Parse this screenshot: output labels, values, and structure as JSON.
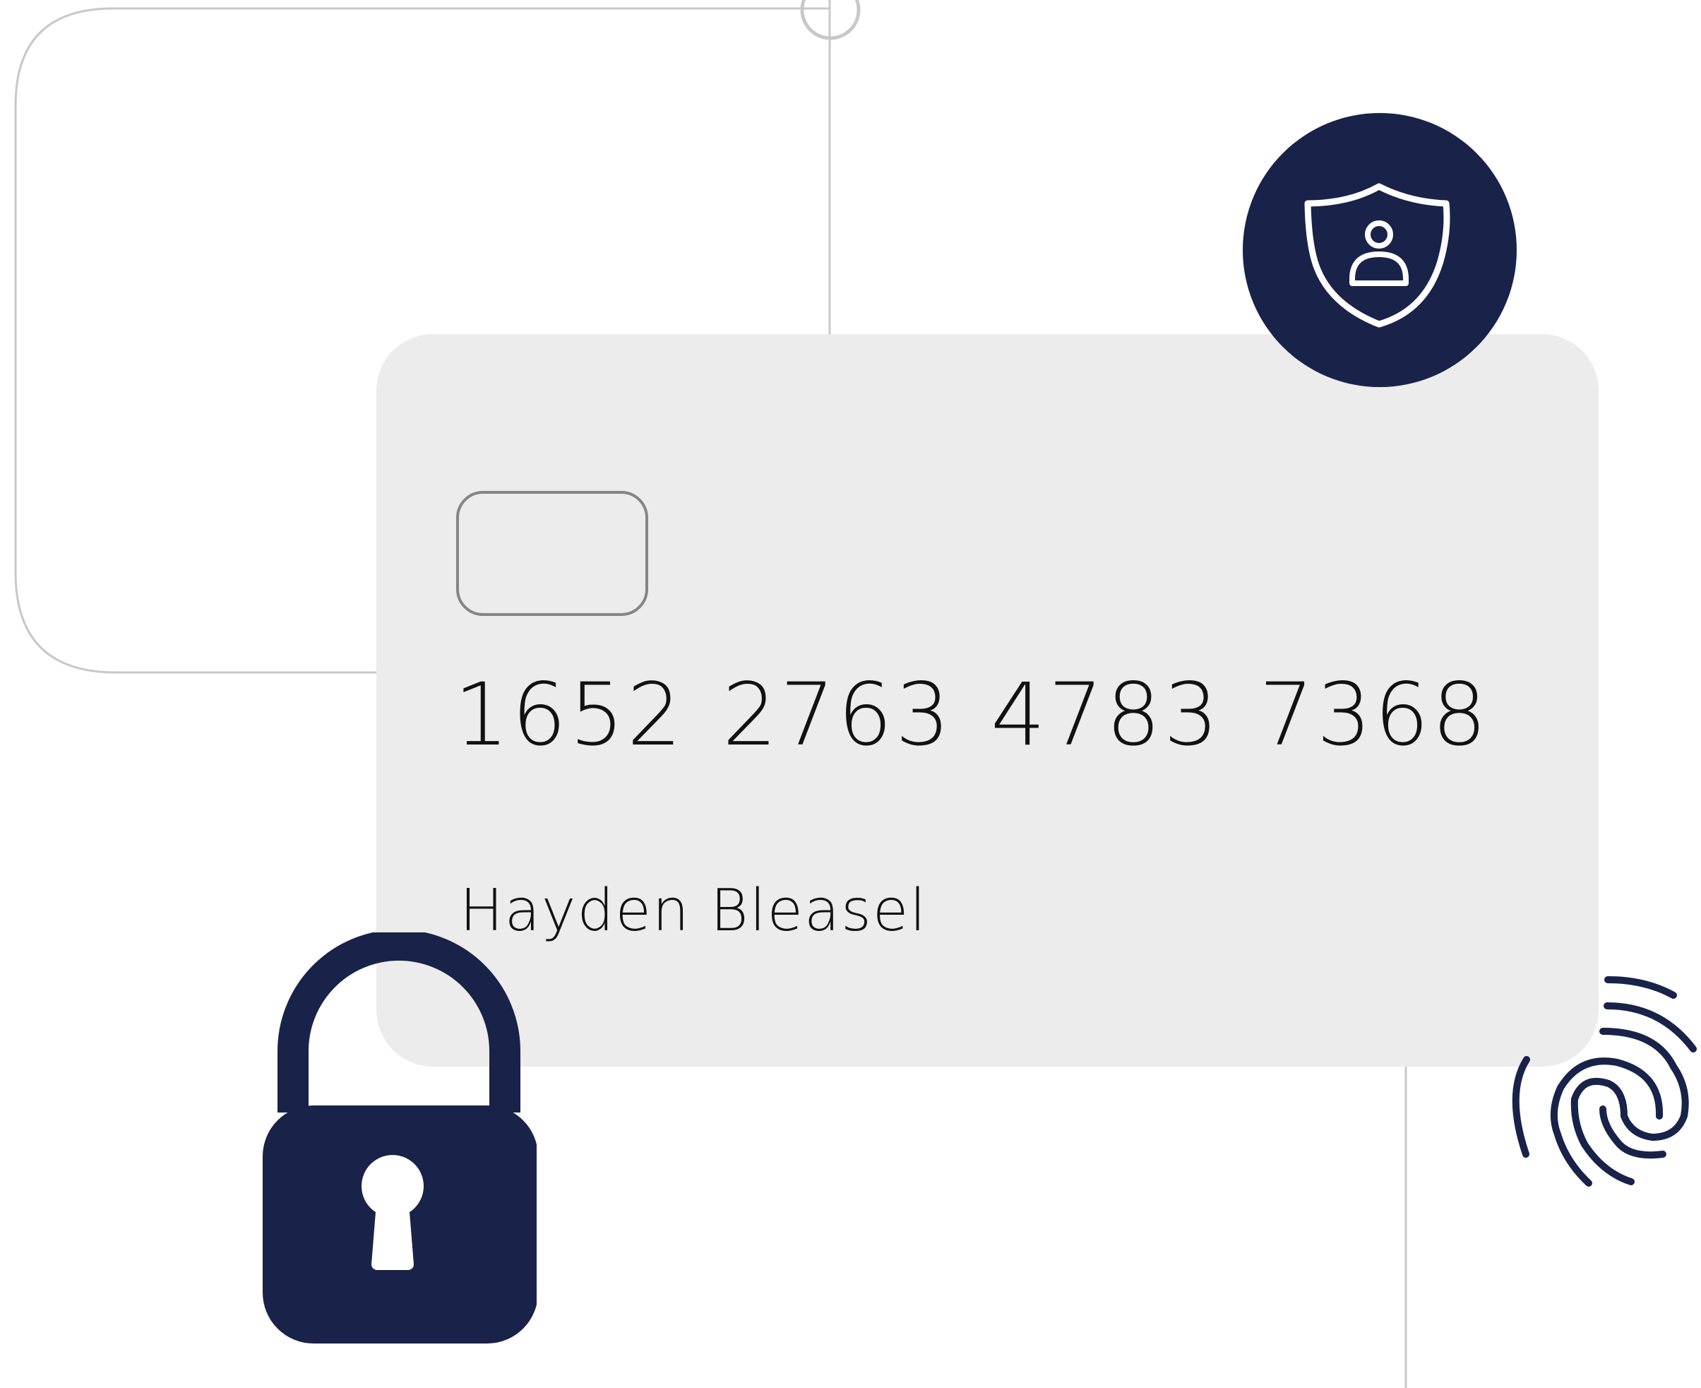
{
  "card": {
    "number_groups": [
      "1652",
      "2763",
      "4783",
      "7368"
    ],
    "holder_name": "Hayden Bleasel"
  },
  "icons": {
    "badge": "shield-user-icon",
    "lock": "padlock-icon",
    "fingerprint": "fingerprint-icon",
    "chip": "card-chip-icon"
  },
  "colors": {
    "navy": "#192248",
    "card_bg": "#ececec",
    "outline": "#c8c8c8",
    "text": "#111111"
  }
}
